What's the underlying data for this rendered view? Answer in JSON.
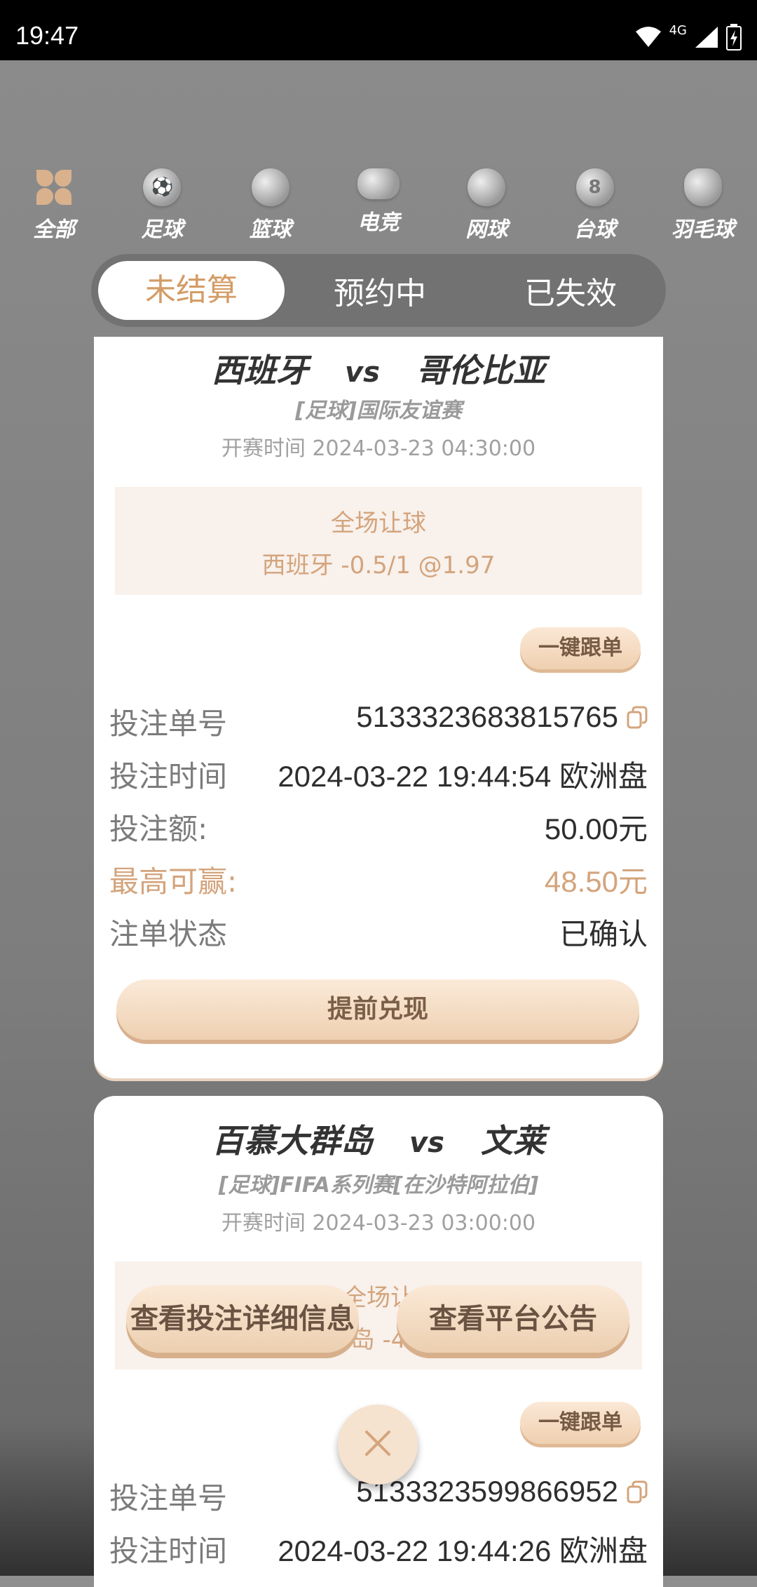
{
  "status_bar": {
    "time": "19:47",
    "network": "4G"
  },
  "categories": [
    {
      "label": "全部",
      "icon": "all-icon"
    },
    {
      "label": "足球",
      "icon": "soccer-icon"
    },
    {
      "label": "篮球",
      "icon": "basketball-icon"
    },
    {
      "label": "电竞",
      "icon": "gamepad-icon"
    },
    {
      "label": "网球",
      "icon": "tennis-icon"
    },
    {
      "label": "台球",
      "icon": "billiards-icon"
    },
    {
      "label": "羽毛球",
      "icon": "badminton-icon"
    }
  ],
  "tabs": [
    {
      "label": "未结算",
      "active": true
    },
    {
      "label": "预约中",
      "active": false
    },
    {
      "label": "已失效",
      "active": false
    }
  ],
  "bets": [
    {
      "home": "西班牙",
      "vs": "vs",
      "away": "哥伦比亚",
      "league": "[足球]国际友谊赛",
      "start_time": "开赛时间 2024-03-23 04:30:00",
      "bet_type": "全场让球",
      "pick": "西班牙  -0.5/1   @1.97",
      "follow_label": "一键跟单",
      "rows": [
        {
          "label": "投注单号",
          "value": "5133323683815765"
        },
        {
          "label": "投注时间",
          "value": "2024-03-22 19:44:54 欧洲盘"
        },
        {
          "label": "投注额:",
          "value": "50.00元"
        },
        {
          "label": "最高可赢:",
          "value": "48.50元"
        },
        {
          "label": "注单状态",
          "value": "已确认"
        }
      ],
      "cashout_label": "提前兑现"
    },
    {
      "home": "百慕大群岛",
      "vs": "vs",
      "away": "文莱",
      "league": "[足球]FIFA系列赛[在沙特阿拉伯]",
      "start_time": "开赛时间 2024-03-23 03:00:00",
      "bet_type": "全场让",
      "pick": "岛  -4",
      "follow_label": "一键跟单",
      "rows": [
        {
          "label": "投注单号",
          "value": "5133323599866952"
        },
        {
          "label": "投注时间",
          "value": "2024-03-22 19:44:26 欧洲盘"
        }
      ]
    }
  ],
  "overlay": {
    "details_label": "查看投注详细信息",
    "notice_label": "查看平台公告"
  },
  "colors": {
    "accent": "#d49c66",
    "highlight": "#d4a47c"
  }
}
